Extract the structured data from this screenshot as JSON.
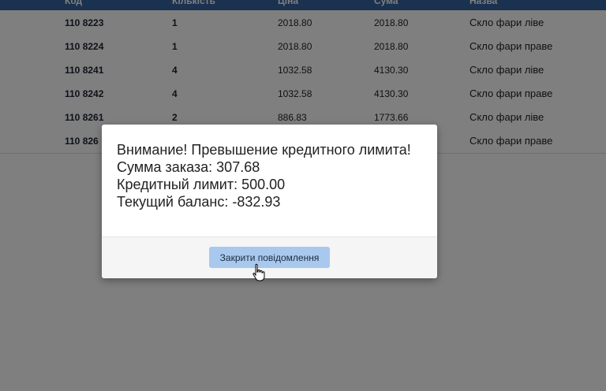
{
  "table": {
    "headers": [
      "Код",
      "Кількість",
      "Ціна",
      "Сума",
      "Назва"
    ],
    "rows": [
      {
        "code": "110 8223",
        "qty": "1",
        "price": "2018.80",
        "sum": "2018.80",
        "name": "Скло фари ліве"
      },
      {
        "code": "110 8224",
        "qty": "1",
        "price": "2018.80",
        "sum": "2018.80",
        "name": "Скло фари праве"
      },
      {
        "code": "110 8241",
        "qty": "4",
        "price": "1032.58",
        "sum": "4130.30",
        "name": "Скло фари ліве"
      },
      {
        "code": "110 8242",
        "qty": "4",
        "price": "1032.58",
        "sum": "4130.30",
        "name": "Скло фари праве"
      },
      {
        "code": "110 8261",
        "qty": "2",
        "price": "886.83",
        "sum": "1773.66",
        "name": "Скло фари ліве"
      },
      {
        "code": "110 826",
        "qty": "",
        "price": "",
        "sum": "",
        "name": "Скло фари праве"
      }
    ]
  },
  "modal": {
    "lines": [
      "Внимание! Превышение кредитного лимита!",
      "Сумма заказа: 307.68",
      "Кредитный лимит: 500.00",
      "Текущий баланс: -832.93"
    ],
    "close_button_label": "Закрити повідомлення"
  },
  "colors": {
    "header_bg": "#34629e",
    "button_bg": "#a9c8ee",
    "overlay": "rgba(0,0,0,0.5)"
  },
  "icons": {
    "cursor": "hand-pointer-icon"
  }
}
